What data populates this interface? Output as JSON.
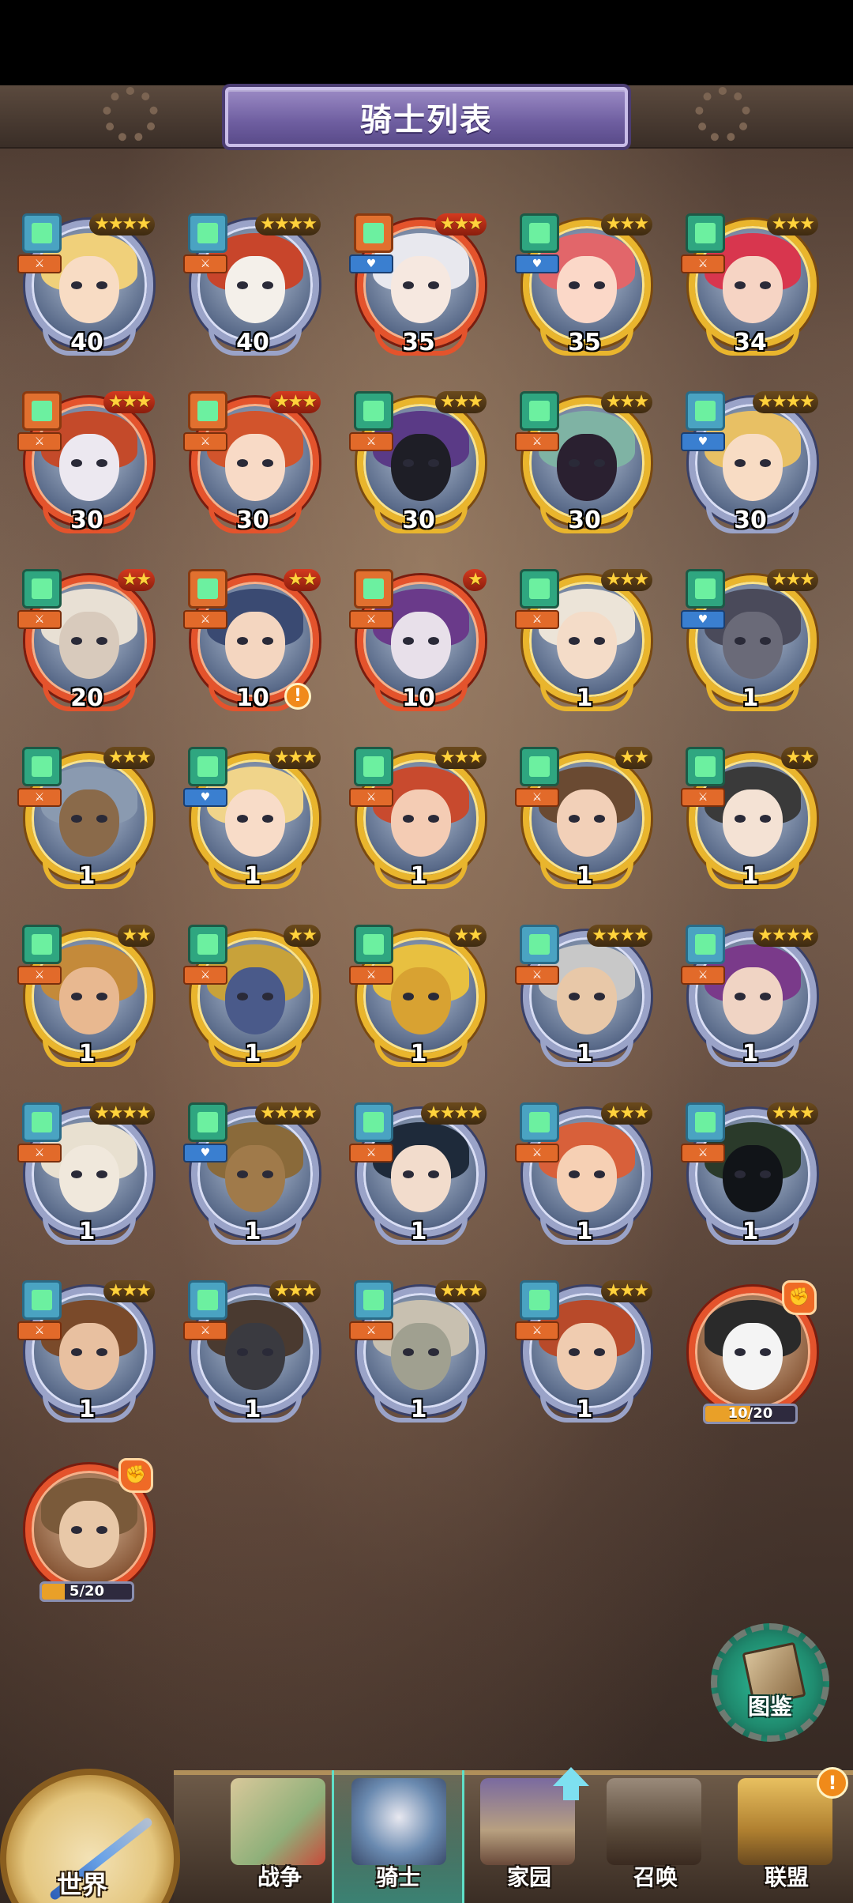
{
  "header": {
    "title": "骑士列表"
  },
  "knights": [
    {
      "level": "40",
      "stars": "★★★★",
      "quality": "blue",
      "cls": "blue",
      "role": "⚔",
      "hair": "#f0d07a",
      "skin": "#f8dcc4"
    },
    {
      "level": "40",
      "stars": "★★★★",
      "quality": "blue",
      "cls": "blue",
      "role": "⚔",
      "hair": "#c8452b",
      "skin": "#f4f0ea"
    },
    {
      "level": "35",
      "stars": "★★★",
      "quality": "red",
      "cls": "orange",
      "role": "♥",
      "hair": "#e8e8ee",
      "skin": "#f6e8e0"
    },
    {
      "level": "35",
      "stars": "★★★",
      "quality": "gold",
      "cls": "green",
      "role": "♥",
      "hair": "#e2666a",
      "skin": "#fbd8c8"
    },
    {
      "level": "34",
      "stars": "★★★",
      "quality": "gold",
      "cls": "green",
      "role": "⚔",
      "hair": "#d8364e",
      "skin": "#f6d4c4"
    },
    {
      "level": "30",
      "stars": "★★★",
      "quality": "red",
      "cls": "orange",
      "role": "⚔",
      "hair": "#c44a2a",
      "skin": "#ece8f0"
    },
    {
      "level": "30",
      "stars": "★★★",
      "quality": "red",
      "cls": "orange",
      "role": "⚔",
      "hair": "#d2542c",
      "skin": "#f8dac6"
    },
    {
      "level": "30",
      "stars": "★★★",
      "quality": "gold",
      "cls": "green",
      "role": "⚔",
      "hair": "#5a3a86",
      "skin": "#1e1e26"
    },
    {
      "level": "30",
      "stars": "★★★",
      "quality": "gold",
      "cls": "green",
      "role": "⚔",
      "hair": "#7fb3a4",
      "skin": "#2a2030"
    },
    {
      "level": "30",
      "stars": "★★★★",
      "quality": "blue",
      "cls": "blue",
      "role": "♥",
      "hair": "#e8c064",
      "skin": "#f8dcc4"
    },
    {
      "level": "20",
      "stars": "★★",
      "quality": "red",
      "cls": "green",
      "role": "⚔",
      "hair": "#e8e0d4",
      "skin": "#d8cabc"
    },
    {
      "level": "10",
      "stars": "★★",
      "quality": "red",
      "cls": "orange",
      "role": "⚔",
      "hair": "#3a4a72",
      "skin": "#f4d6c0",
      "alert": "!"
    },
    {
      "level": "10",
      "stars": "★",
      "quality": "red",
      "cls": "orange",
      "role": "⚔",
      "hair": "#6a3a8a",
      "skin": "#e8e0ea"
    },
    {
      "level": "1",
      "stars": "★★★",
      "quality": "gold",
      "cls": "green",
      "role": "⚔",
      "hair": "#ece4d8",
      "skin": "#f4dcc8"
    },
    {
      "level": "1",
      "stars": "★★★",
      "quality": "gold",
      "cls": "green",
      "role": "♥",
      "hair": "#4a4a5a",
      "skin": "#6a6a78"
    },
    {
      "level": "1",
      "stars": "★★★",
      "quality": "gold",
      "cls": "green",
      "role": "⚔",
      "hair": "#8a9ab0",
      "skin": "#8a6a4a"
    },
    {
      "level": "1",
      "stars": "★★★",
      "quality": "gold",
      "cls": "green",
      "role": "♥",
      "hair": "#f0d48a",
      "skin": "#f8dcc8"
    },
    {
      "level": "1",
      "stars": "★★★",
      "quality": "gold",
      "cls": "green",
      "role": "⚔",
      "hair": "#c84a2e",
      "skin": "#f4ccb4"
    },
    {
      "level": "1",
      "stars": "★★",
      "quality": "gold",
      "cls": "green",
      "role": "⚔",
      "hair": "#6a4a32",
      "skin": "#f2d0b8"
    },
    {
      "level": "1",
      "stars": "★★",
      "quality": "gold",
      "cls": "green",
      "role": "⚔",
      "hair": "#3a3a3a",
      "skin": "#f4e2d4"
    },
    {
      "level": "1",
      "stars": "★★",
      "quality": "gold",
      "cls": "green",
      "role": "⚔",
      "hair": "#c48a3a",
      "skin": "#e8b890"
    },
    {
      "level": "1",
      "stars": "★★",
      "quality": "gold",
      "cls": "green",
      "role": "⚔",
      "hair": "#c8a23a",
      "skin": "#4a5a8a"
    },
    {
      "level": "1",
      "stars": "★★",
      "quality": "gold",
      "cls": "green",
      "role": "⚔",
      "hair": "#e8c040",
      "skin": "#d8a232"
    },
    {
      "level": "1",
      "stars": "★★★★",
      "quality": "blue",
      "cls": "blue",
      "role": "⚔",
      "hair": "#c8c8c8",
      "skin": "#e8c8a8"
    },
    {
      "level": "1",
      "stars": "★★★★",
      "quality": "blue",
      "cls": "blue",
      "role": "⚔",
      "hair": "#7a3a8a",
      "skin": "#f0d4c4"
    },
    {
      "level": "1",
      "stars": "★★★★",
      "quality": "blue",
      "cls": "blue",
      "role": "⚔",
      "hair": "#e8e0d0",
      "skin": "#f0e8dc"
    },
    {
      "level": "1",
      "stars": "★★★★",
      "quality": "blue",
      "cls": "green",
      "role": "♥",
      "hair": "#8a6a3a",
      "skin": "#a07a4a"
    },
    {
      "level": "1",
      "stars": "★★★★",
      "quality": "blue",
      "cls": "blue",
      "role": "⚔",
      "hair": "#1e2a3a",
      "skin": "#f2dccc"
    },
    {
      "level": "1",
      "stars": "★★★",
      "quality": "blue",
      "cls": "blue",
      "role": "⚔",
      "hair": "#d8603a",
      "skin": "#f6d0b4"
    },
    {
      "level": "1",
      "stars": "★★★",
      "quality": "blue",
      "cls": "blue",
      "role": "⚔",
      "hair": "#2a3a2a",
      "skin": "#111418"
    },
    {
      "level": "1",
      "stars": "★★★",
      "quality": "blue",
      "cls": "blue",
      "role": "⚔",
      "hair": "#7a4a2a",
      "skin": "#e8c0a0"
    },
    {
      "level": "1",
      "stars": "★★★",
      "quality": "blue",
      "cls": "blue",
      "role": "⚔",
      "hair": "#4a3a30",
      "skin": "#3a3a40"
    },
    {
      "level": "1",
      "stars": "★★★",
      "quality": "blue",
      "cls": "blue",
      "role": "⚔",
      "hair": "#c8c0b0",
      "skin": "#a0a090"
    },
    {
      "level": "1",
      "stars": "★★★",
      "quality": "blue",
      "cls": "blue",
      "role": "⚔",
      "hair": "#b84a2a",
      "skin": "#f0ccb0"
    }
  ],
  "fragment_knights": [
    {
      "progress_text": "10/20",
      "progress": 0.5,
      "hair": "#2a2a2a",
      "skin": "#f4f4f4"
    },
    {
      "progress_text": "5/20",
      "progress": 0.25,
      "hair": "#7a5a3a",
      "skin": "#e8c8a8"
    }
  ],
  "codex_button": {
    "label": "图鉴"
  },
  "bottom_nav": {
    "world": "世界",
    "tabs": [
      {
        "label": "战争",
        "active": false
      },
      {
        "label": "骑士",
        "active": true
      },
      {
        "label": "家园",
        "active": false
      },
      {
        "label": "召唤",
        "active": false
      },
      {
        "label": "联盟",
        "active": false
      }
    ],
    "alliance_alert": "!"
  }
}
